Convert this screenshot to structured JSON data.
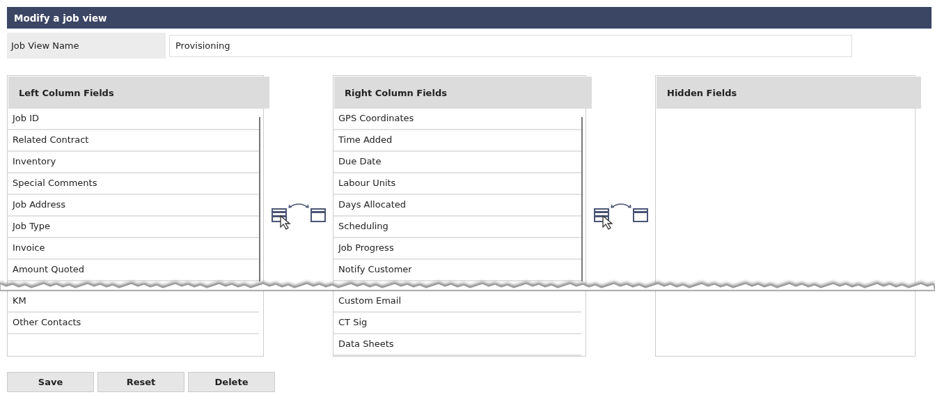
{
  "header": {
    "title": "Modify a job view"
  },
  "name_field": {
    "label": "Job View Name",
    "value": "Provisioning"
  },
  "columns": [
    {
      "title": "Left Column Fields",
      "items": [
        "Job ID",
        "Related Contract",
        "Inventory",
        "Special Comments",
        "Job Address",
        "Job Type",
        "Invoice",
        "Amount Quoted",
        "KM",
        "Other Contacts"
      ]
    },
    {
      "title": "Right Column Fields",
      "items": [
        "GPS Coordinates",
        "Time Added",
        "Due Date",
        "Labour Units",
        "Days Allocated",
        "Scheduling",
        "Job Progress",
        "Notify Customer",
        "Custom Email",
        "CT Sig",
        "Data Sheets"
      ]
    },
    {
      "title": "Hidden Fields"
    }
  ],
  "buttons": [
    "Save",
    "Reset",
    "Delete"
  ]
}
